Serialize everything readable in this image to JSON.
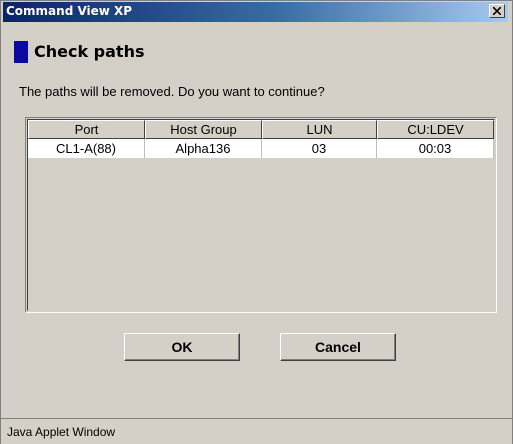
{
  "window": {
    "title": "Command View XP",
    "close_icon": "close-icon"
  },
  "dialog": {
    "heading": "Check paths",
    "message": "The paths will be removed. Do you want to continue?"
  },
  "table": {
    "columns": [
      "Port",
      "Host Group",
      "LUN",
      "CU:LDEV"
    ],
    "rows": [
      [
        "CL1-A(88)",
        "Alpha136",
        "03",
        "00:03"
      ]
    ]
  },
  "buttons": {
    "ok_label": "OK",
    "cancel_label": "Cancel"
  },
  "statusbar": {
    "text": "Java Applet Window"
  },
  "colors": {
    "title_bar": "#0a246a",
    "heading_marker": "#0a0aa0",
    "window_bg": "#d4d0c8"
  }
}
